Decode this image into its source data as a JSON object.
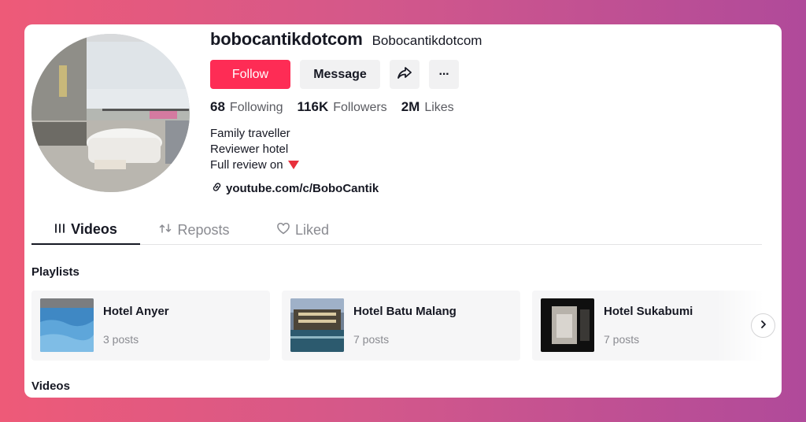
{
  "profile": {
    "username": "bobocantikdotcom",
    "nickname": "Bobocantikdotcom",
    "follow_label": "Follow",
    "message_label": "Message",
    "share_icon": "share-icon",
    "more_icon": "more-icon",
    "more_label": "···"
  },
  "stats": [
    {
      "num": "68",
      "label": "Following"
    },
    {
      "num": "116K",
      "label": "Followers"
    },
    {
      "num": "2M",
      "label": "Likes"
    }
  ],
  "bio": {
    "line1": "Family traveller",
    "line2": "Reviewer hotel",
    "line3": "Full review on"
  },
  "link": {
    "text": "youtube.com/c/BoboCantik",
    "icon": "link-icon"
  },
  "tabs": [
    {
      "label": "Videos",
      "icon": "grid-icon",
      "active": true
    },
    {
      "label": "Reposts",
      "icon": "repost-icon",
      "active": false
    },
    {
      "label": "Liked",
      "icon": "heart-icon",
      "active": false
    }
  ],
  "sections": {
    "playlists": "Playlists",
    "videos": "Videos"
  },
  "playlists": [
    {
      "name": "Hotel Anyer",
      "count": "3 posts"
    },
    {
      "name": "Hotel Batu Malang",
      "count": "7 posts"
    },
    {
      "name": "Hotel Sukabumi",
      "count": "7 posts"
    }
  ],
  "colors": {
    "accent": "#fe2c55",
    "text": "#161823",
    "muted": "#8a8b91"
  }
}
